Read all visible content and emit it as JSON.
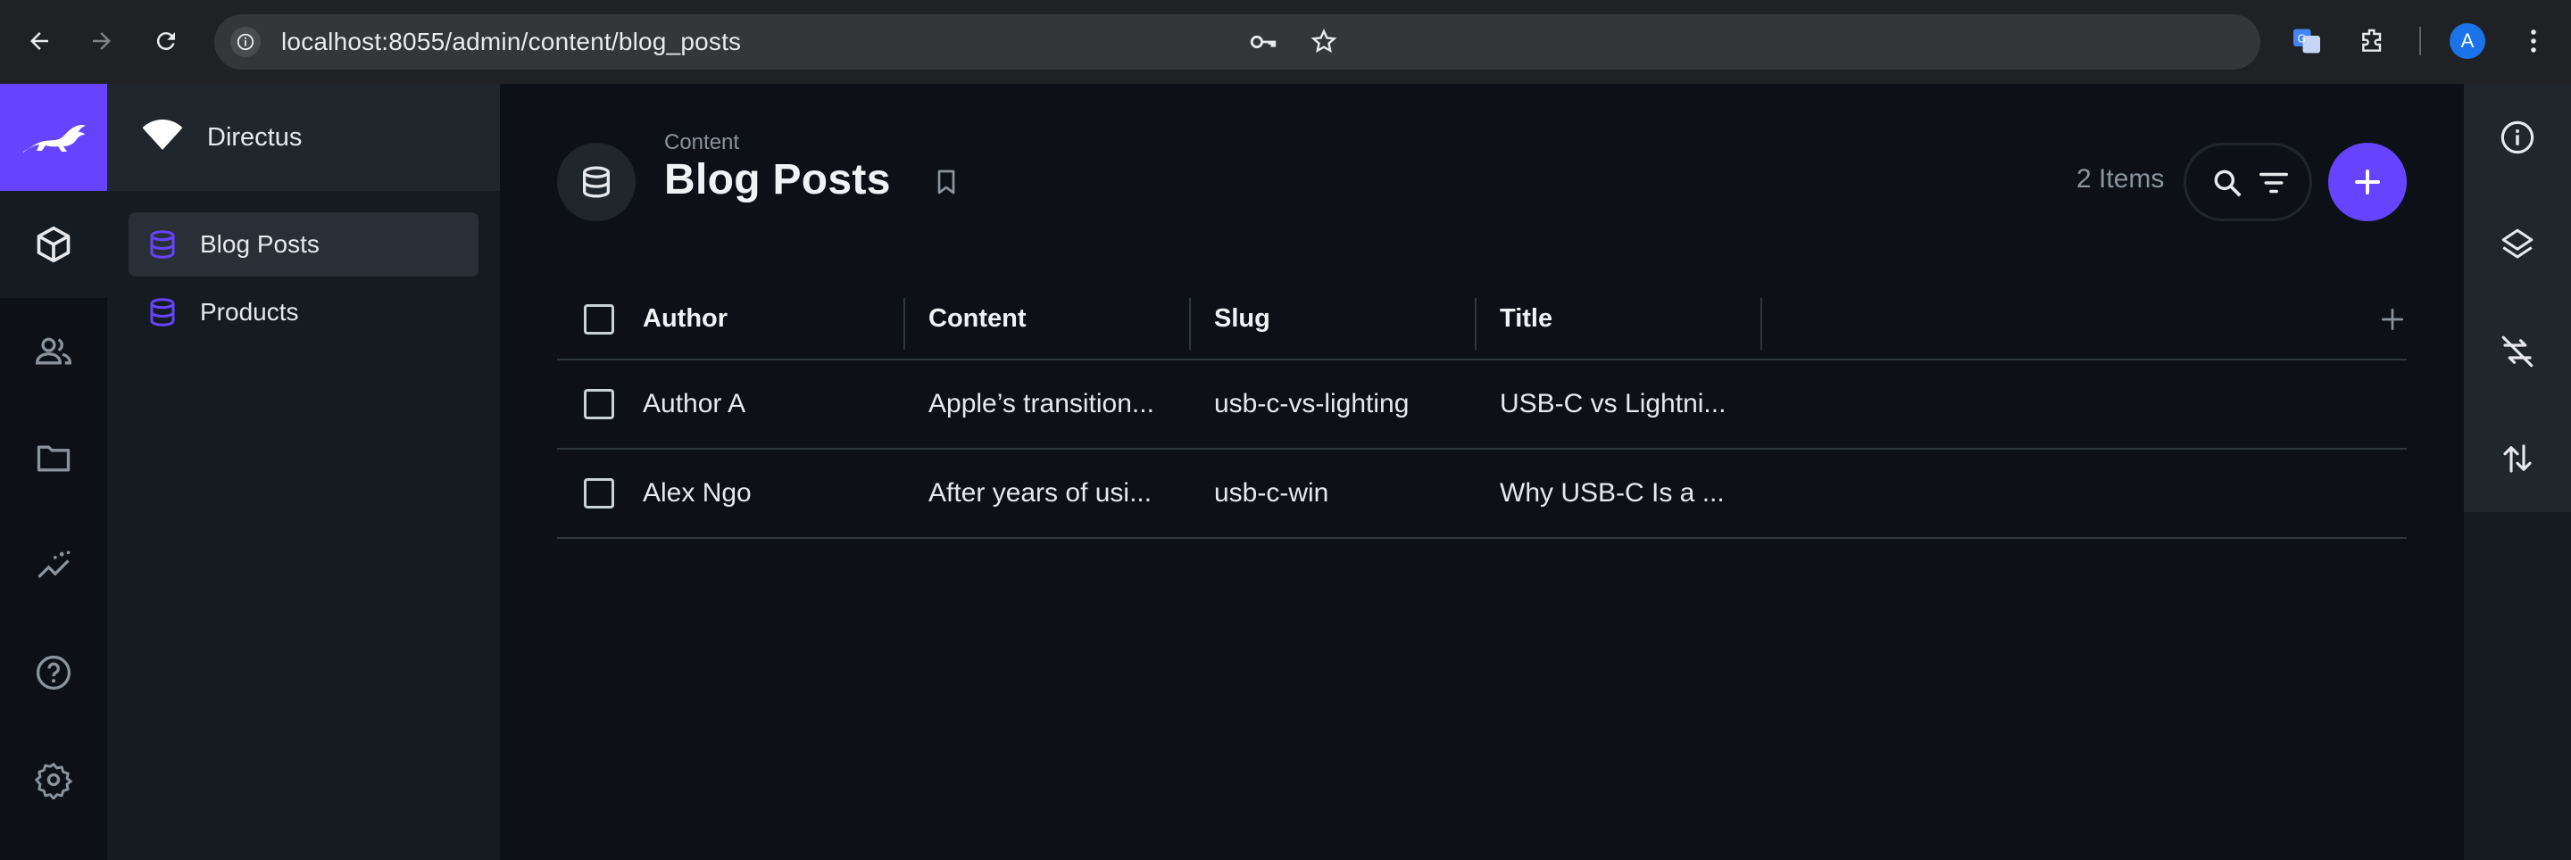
{
  "browser": {
    "url": "localhost:8055/admin/content/blog_posts",
    "profile_initial": "A"
  },
  "project": {
    "name": "Directus"
  },
  "nav": {
    "items": [
      {
        "label": "Blog Posts",
        "active": true
      },
      {
        "label": "Products",
        "active": false
      }
    ]
  },
  "header": {
    "breadcrumb": "Content",
    "title": "Blog Posts",
    "item_count": "2 Items"
  },
  "table": {
    "columns": [
      "Author",
      "Content",
      "Slug",
      "Title"
    ],
    "rows": [
      {
        "author": "Author A",
        "content": "Apple’s transition...",
        "slug": "usb-c-vs-lighting",
        "title": "USB-C vs Lightni..."
      },
      {
        "author": "Alex Ngo",
        "content": "After years of usi...",
        "slug": "usb-c-win",
        "title": "Why USB-C Is a ..."
      }
    ]
  },
  "colors": {
    "accent": "#6644ff",
    "background": "#0d1117",
    "nav_background": "#161b22"
  },
  "icons": {
    "rail": [
      "content-cube-icon",
      "users-icon",
      "folder-icon",
      "insights-icon",
      "help-icon",
      "settings-icon"
    ],
    "right_sidebar": [
      "info-icon",
      "layers-icon",
      "sync-off-icon",
      "import-export-icon"
    ]
  }
}
